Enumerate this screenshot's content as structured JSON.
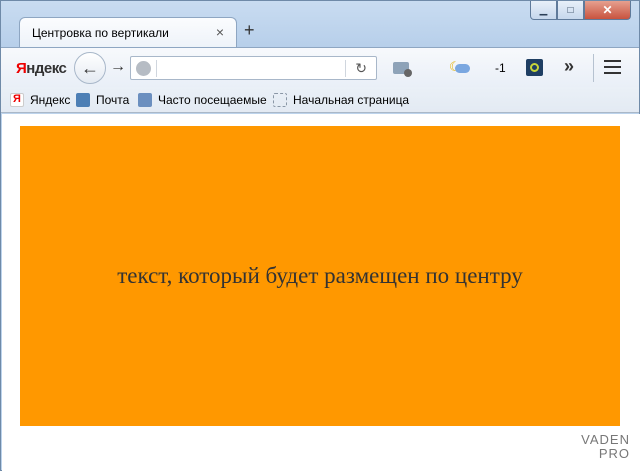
{
  "window": {
    "tab_title": "Центровка по вертикали",
    "tab_close": "×",
    "new_tab": "+",
    "controls": {
      "minimize": "▁",
      "maximize": "□",
      "close": "✕"
    }
  },
  "toolbar": {
    "logo_first": "Я",
    "logo_rest": "ндекс",
    "back": "←",
    "forward": "→",
    "url_value": "",
    "reload": "↻",
    "weather_temp": "-1",
    "overflow": "»"
  },
  "bookmarks": [
    {
      "label": "Яндекс",
      "icon": "yandex-icon"
    },
    {
      "label": "Почта",
      "icon": "mail-icon"
    },
    {
      "label": "Часто посещаемые",
      "icon": "most-visited-icon"
    },
    {
      "label": "Начальная страница",
      "icon": "home-page-icon"
    }
  ],
  "page": {
    "centered_text": "текст, который будет размещен по центру",
    "block_color": "#ff9800",
    "watermark_line1": "VADEN",
    "watermark_line2": "PRO"
  }
}
